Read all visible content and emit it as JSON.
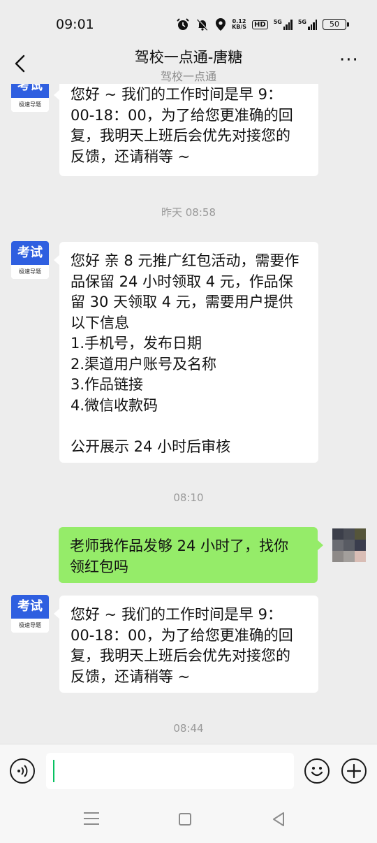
{
  "status_bar": {
    "time": "09:01",
    "net_speed_value": "0.12",
    "net_speed_unit": "KB/S",
    "hd_label": "HD",
    "sim1_label": "5G",
    "sim2_label": "5G",
    "battery": "50"
  },
  "header": {
    "title": "驾校一点通-唐糖",
    "subtitle": "驾校一点通",
    "more_label": "···"
  },
  "contact_avatar": {
    "top_text": "考试",
    "bottom_text": "极速导题",
    "brand_color": "#2f5fe0"
  },
  "messages": [
    {
      "type": "received",
      "text": "您好 ~ 我们的工作时间是早 9：\n00-18：00，为了给您更准确的回\n复，我明天上班后会优先对接您的\n反馈，还请稍等 ~"
    },
    {
      "type": "timestamp",
      "text": "昨天 08:58"
    },
    {
      "type": "received",
      "text": "您好 亲 8 元推广红包活动，需要作\n品保留 24 小时领取 4 元，作品保\n留 30 天领取 4 元，需要用户提供\n以下信息\n1.手机号，发布日期\n2.渠道用户账号及名称\n3.作品链接\n4.微信收款码\n\n公开展示 24 小时后审核"
    },
    {
      "type": "timestamp",
      "text": "08:10"
    },
    {
      "type": "sent",
      "text": "老师我作品发够 24 小时了，找你\n领红包吗"
    },
    {
      "type": "received",
      "text": "您好 ~ 我们的工作时间是早 9：\n00-18：00，为了给您更准确的回\n复，我明天上班后会优先对接您的\n反馈，还请稍等 ~"
    },
    {
      "type": "timestamp",
      "text": "08:44"
    }
  ],
  "input_bar": {
    "voice_icon": "voice-icon",
    "emoji_icon": "emoji-icon",
    "plus_icon": "plus-icon",
    "value": "",
    "placeholder": ""
  },
  "colors": {
    "sent_bubble": "#95ec69",
    "received_bubble": "#ffffff",
    "background": "#ededed",
    "caret": "#07c160"
  }
}
